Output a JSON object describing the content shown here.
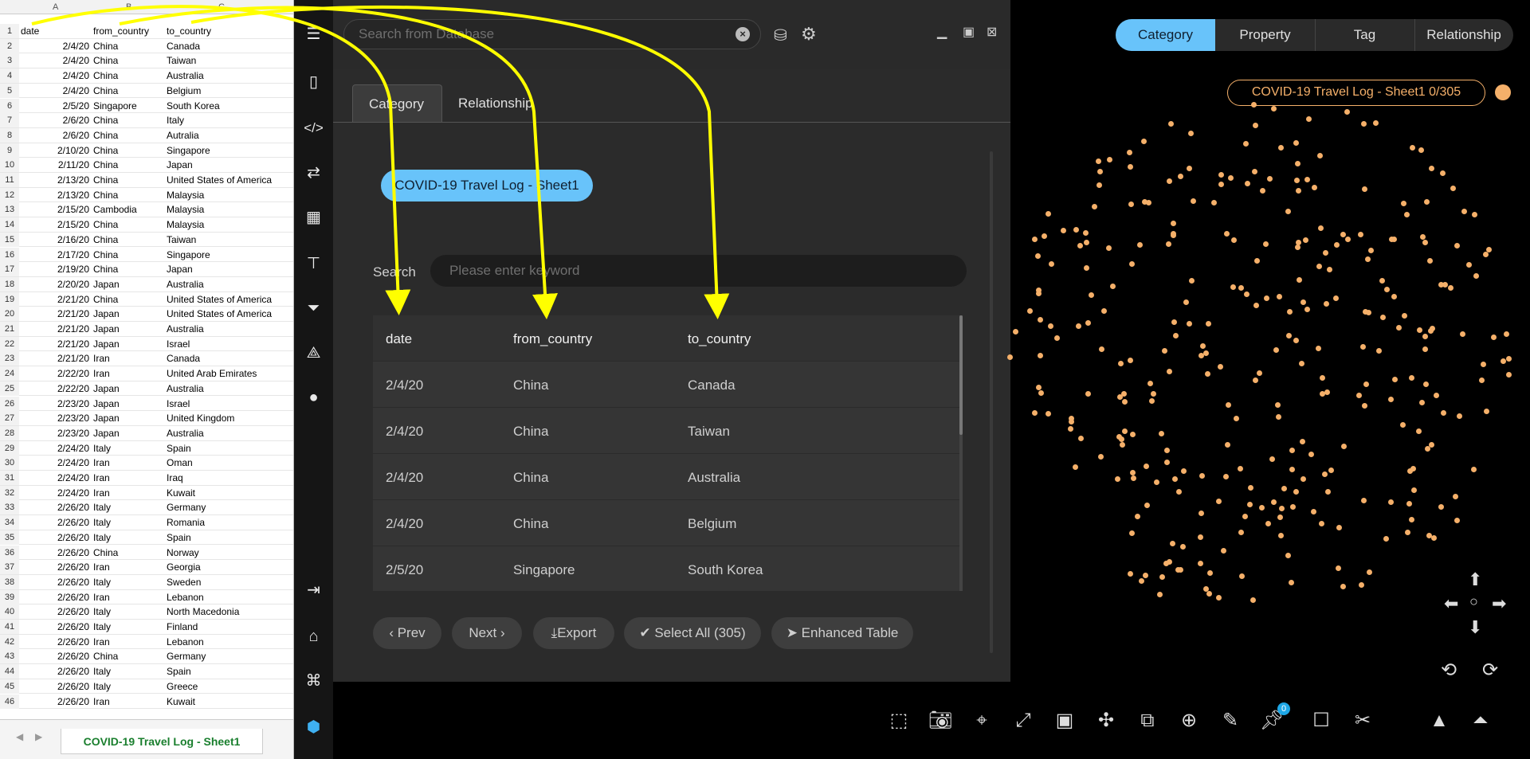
{
  "spreadsheet": {
    "col_letters": [
      "A",
      "B",
      "C"
    ],
    "header": [
      "date",
      "from_country",
      "to_country"
    ],
    "rows": [
      [
        "2/4/20",
        "China",
        "Canada"
      ],
      [
        "2/4/20",
        "China",
        "Taiwan"
      ],
      [
        "2/4/20",
        "China",
        "Australia"
      ],
      [
        "2/4/20",
        "China",
        "Belgium"
      ],
      [
        "2/5/20",
        "Singapore",
        "South Korea"
      ],
      [
        "2/6/20",
        "China",
        "Italy"
      ],
      [
        "2/6/20",
        "China",
        "Autralia"
      ],
      [
        "2/10/20",
        "China",
        "Singapore"
      ],
      [
        "2/11/20",
        "China",
        "Japan"
      ],
      [
        "2/13/20",
        "China",
        "United States of America"
      ],
      [
        "2/13/20",
        "China",
        "Malaysia"
      ],
      [
        "2/15/20",
        "Cambodia",
        "Malaysia"
      ],
      [
        "2/15/20",
        "China",
        "Malaysia"
      ],
      [
        "2/16/20",
        "China",
        "Taiwan"
      ],
      [
        "2/17/20",
        "China",
        "Singapore"
      ],
      [
        "2/19/20",
        "China",
        "Japan"
      ],
      [
        "2/20/20",
        "Japan",
        "Australia"
      ],
      [
        "2/21/20",
        "China",
        "United States of America"
      ],
      [
        "2/21/20",
        "Japan",
        "United States of America"
      ],
      [
        "2/21/20",
        "Japan",
        "Australia"
      ],
      [
        "2/21/20",
        "Japan",
        "Israel"
      ],
      [
        "2/21/20",
        "Iran",
        "Canada"
      ],
      [
        "2/22/20",
        "Iran",
        "United Arab Emirates"
      ],
      [
        "2/22/20",
        "Japan",
        "Australia"
      ],
      [
        "2/23/20",
        "Japan",
        "Israel"
      ],
      [
        "2/23/20",
        "Japan",
        "United Kingdom"
      ],
      [
        "2/23/20",
        "Japan",
        "Australia"
      ],
      [
        "2/24/20",
        "Italy",
        "Spain"
      ],
      [
        "2/24/20",
        "Iran",
        "Oman"
      ],
      [
        "2/24/20",
        "Iran",
        "Iraq"
      ],
      [
        "2/24/20",
        "Iran",
        "Kuwait"
      ],
      [
        "2/26/20",
        "Italy",
        "Germany"
      ],
      [
        "2/26/20",
        "Italy",
        "Romania"
      ],
      [
        "2/26/20",
        "Italy",
        "Spain"
      ],
      [
        "2/26/20",
        "China",
        "Norway"
      ],
      [
        "2/26/20",
        "Iran",
        "Georgia"
      ],
      [
        "2/26/20",
        "Italy",
        "Sweden"
      ],
      [
        "2/26/20",
        "Iran",
        "Lebanon"
      ],
      [
        "2/26/20",
        "Italy",
        "North Macedonia"
      ],
      [
        "2/26/20",
        "Italy",
        "Finland"
      ],
      [
        "2/26/20",
        "Iran",
        "Lebanon"
      ],
      [
        "2/26/20",
        "China",
        "Germany"
      ],
      [
        "2/26/20",
        "Italy",
        "Spain"
      ],
      [
        "2/26/20",
        "Italy",
        "Greece"
      ],
      [
        "2/26/20",
        "Iran",
        "Kuwait"
      ]
    ],
    "row_numbers": [
      "1",
      "2",
      "3",
      "4",
      "5",
      "6",
      "7",
      "8",
      "9",
      "10",
      "11",
      "12",
      "13",
      "14",
      "15",
      "16",
      "17",
      "18",
      "19",
      "20",
      "21",
      "22",
      "23",
      "24",
      "25",
      "26",
      "27",
      "28",
      "29",
      "30",
      "31",
      "32",
      "33",
      "34",
      "35",
      "36",
      "37",
      "38",
      "39",
      "40",
      "41",
      "42",
      "43",
      "44",
      "45",
      "46"
    ],
    "sheet_tab": "COVID-19 Travel Log - Sheet1"
  },
  "db_panel": {
    "search_placeholder": "Search from Database",
    "tabs": [
      "Category",
      "Relationship"
    ],
    "category_chip": "COVID-19 Travel Log - Sheet1",
    "search_label": "Search",
    "keyword_placeholder": "Please enter keyword",
    "table": {
      "columns": [
        "date",
        "from_country",
        "to_country"
      ],
      "rows": [
        [
          "2/4/20",
          "China",
          "Canada"
        ],
        [
          "2/4/20",
          "China",
          "Taiwan"
        ],
        [
          "2/4/20",
          "China",
          "Australia"
        ],
        [
          "2/4/20",
          "China",
          "Belgium"
        ],
        [
          "2/5/20",
          "Singapore",
          "South Korea"
        ]
      ]
    },
    "buttons": {
      "prev": "Prev",
      "next": "Next",
      "export": "Export",
      "select_all": "Select All (305)",
      "enhanced_table": "Enhanced Table"
    }
  },
  "graph": {
    "top_tabs": [
      "Category",
      "Property",
      "Tag",
      "Relationship"
    ],
    "badge": "COVID-19 Travel Log - Sheet1 0/305",
    "node_color": "#f5b06a",
    "pin_count": "0"
  },
  "colors": {
    "accent_blue": "#68c3fa",
    "node_orange": "#f5b06a",
    "arrow_yellow": "#ffff00",
    "sheet_tab_green": "#1a7f2e"
  }
}
